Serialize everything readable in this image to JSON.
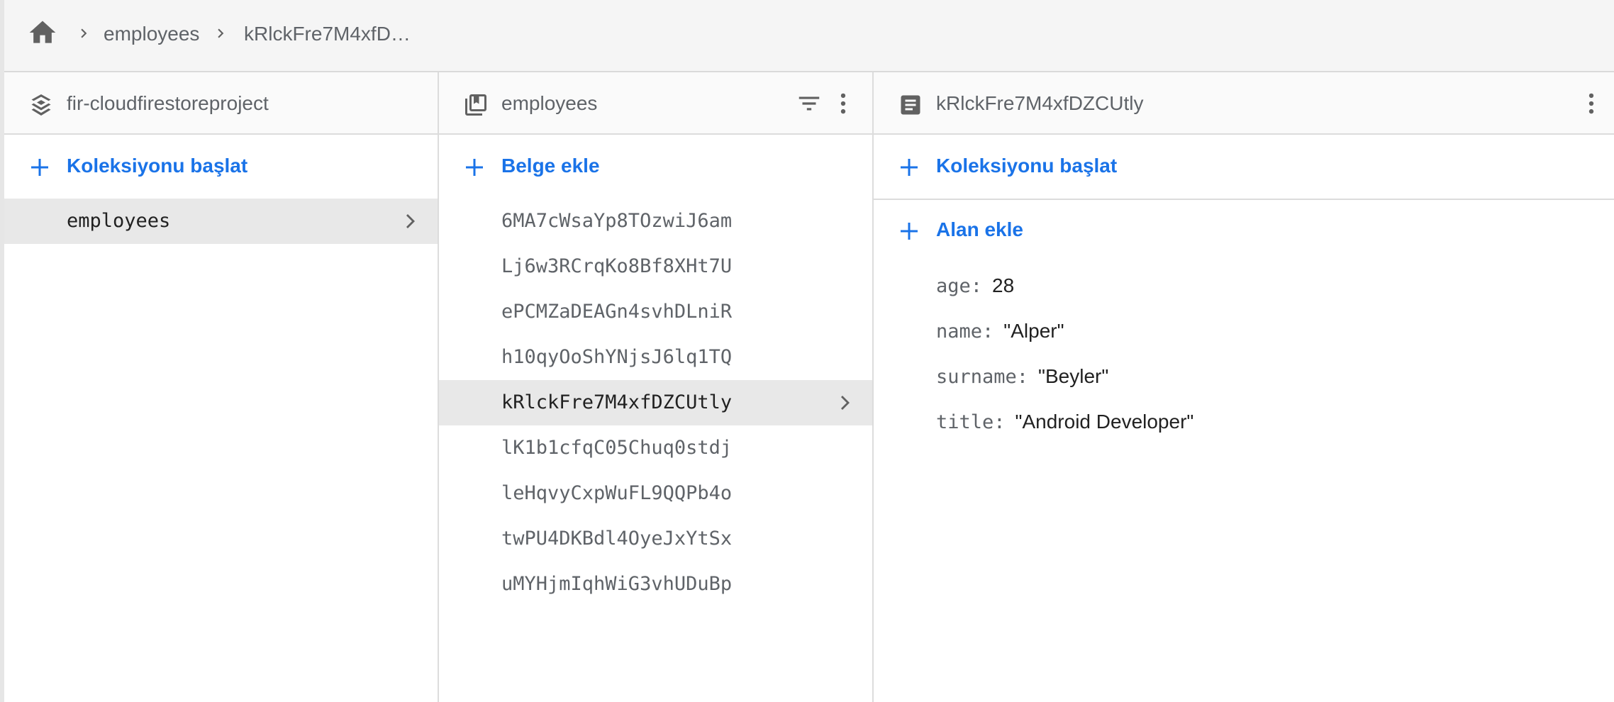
{
  "breadcrumb": {
    "items": [
      "employees",
      "kRlckFre7M4xfD…"
    ]
  },
  "root_panel": {
    "title": "fir-cloudfirestoreproject",
    "add_label": "Koleksiyonu başlat",
    "collections": [
      "employees"
    ]
  },
  "collection_panel": {
    "title": "employees",
    "add_label": "Belge ekle",
    "documents": [
      "6MA7cWsaYp8TOzwiJ6am",
      "Lj6w3RCrqKo8Bf8XHt7U",
      "ePCMZaDEAGn4svhDLniR",
      "h10qyOoShYNjsJ6lq1TQ",
      "kRlckFre7M4xfDZCUtly",
      "lK1b1cfqC05Chuq0stdj",
      "leHqvyCxpWuFL9QQPb4o",
      "twPU4DKBdl4OyeJxYtSx",
      "uMYHjmIqhWiG3vhUDuBp"
    ],
    "selected_index": 4
  },
  "document_panel": {
    "title": "kRlckFre7M4xfDZCUtly",
    "add_collection_label": "Koleksiyonu başlat",
    "add_field_label": "Alan ekle",
    "fields": [
      {
        "key": "age:",
        "value": "28"
      },
      {
        "key": "name:",
        "value": "\"Alper\""
      },
      {
        "key": "surname:",
        "value": "\"Beyler\""
      },
      {
        "key": "title:",
        "value": "\"Android Developer\""
      }
    ]
  },
  "colors": {
    "accent": "#1a73e8",
    "icon_grey": "#5f6368",
    "selected_bg": "#e8e8e8"
  },
  "icons": [
    "home-icon",
    "chevron-right-icon",
    "firestore-stack-icon",
    "collection-icon",
    "filter-icon",
    "more-vert-icon",
    "document-icon",
    "plus-icon"
  ]
}
